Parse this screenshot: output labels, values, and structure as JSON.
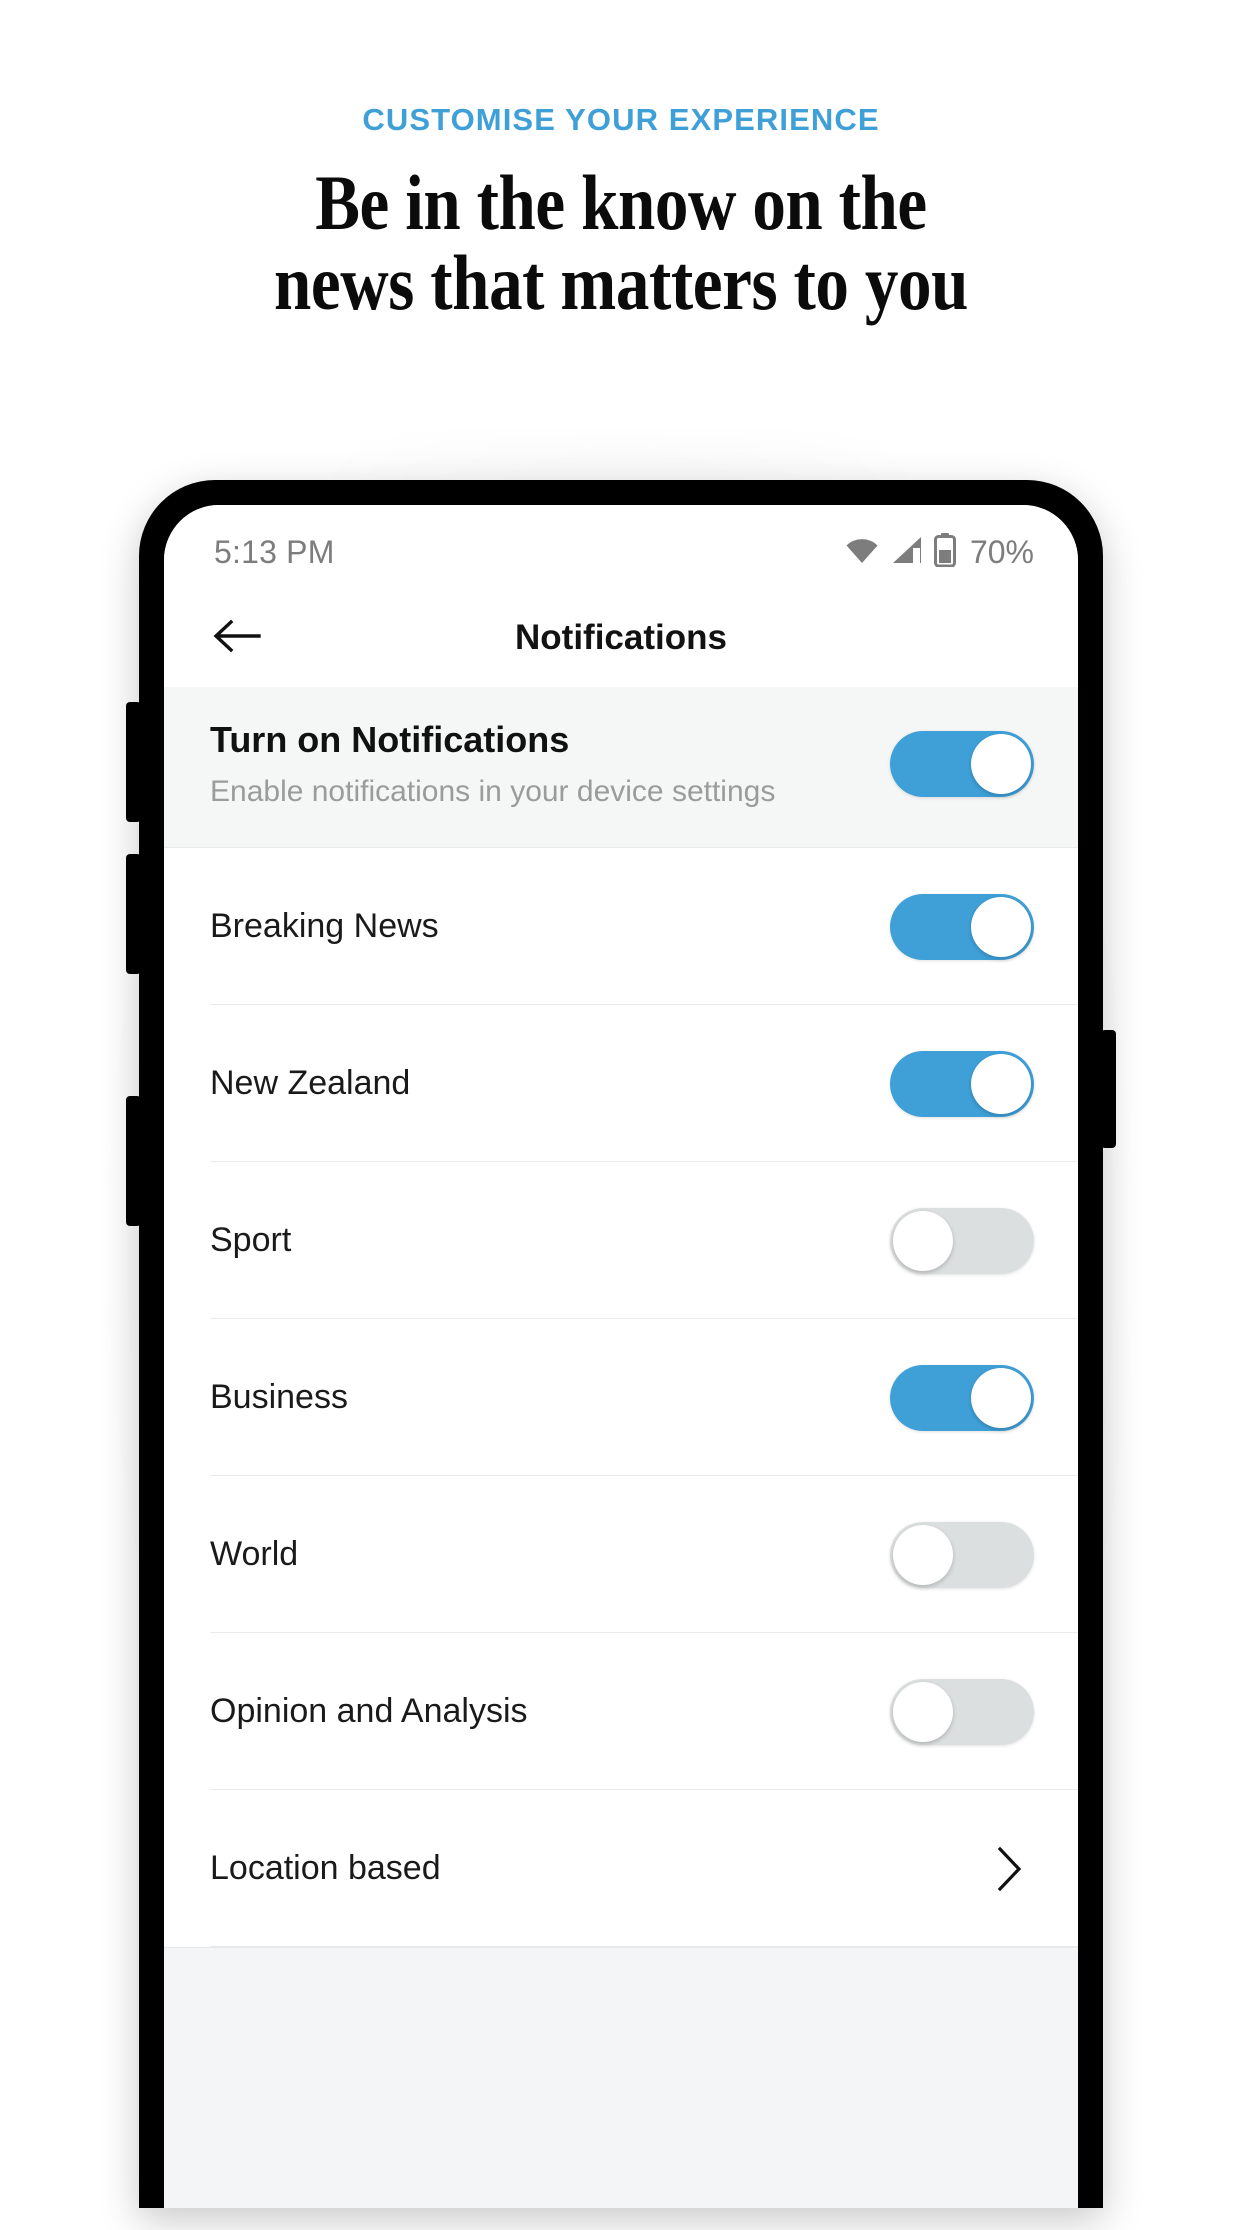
{
  "promo": {
    "eyebrow": "CUSTOMISE YOUR EXPERIENCE",
    "headline_line1": "Be in the know on the",
    "headline_line2": "news that matters to you",
    "accent_color": "#3fa0d8",
    "headline_color": "#0b0b0b"
  },
  "phone": {
    "status_bar": {
      "time": "5:13 PM",
      "battery_percent": "70%",
      "wifi_icon": "wifi-icon",
      "cellular_icon": "cellular-signal-icon",
      "battery_icon": "battery-icon",
      "text_color": "#7d7d7d"
    },
    "app_bar": {
      "back_icon": "back-arrow-icon",
      "title": "Notifications"
    },
    "master_row": {
      "title": "Turn on Notifications",
      "subtitle": "Enable notifications in your device settings",
      "toggle_state": "on",
      "toggle_label": "Turn on Notifications toggle"
    },
    "toggle_colors": {
      "on": "#3fa0d8",
      "off": "#dcdfe0",
      "knob": "#ffffff"
    },
    "rows": [
      {
        "label": "Breaking News",
        "type": "toggle",
        "state": "on"
      },
      {
        "label": "New Zealand",
        "type": "toggle",
        "state": "on"
      },
      {
        "label": "Sport",
        "type": "toggle",
        "state": "off"
      },
      {
        "label": "Business",
        "type": "toggle",
        "state": "on"
      },
      {
        "label": "World",
        "type": "toggle",
        "state": "off"
      },
      {
        "label": "Opinion and Analysis",
        "type": "toggle",
        "state": "off"
      },
      {
        "label": "Location based",
        "type": "chevron",
        "state": ""
      }
    ]
  }
}
